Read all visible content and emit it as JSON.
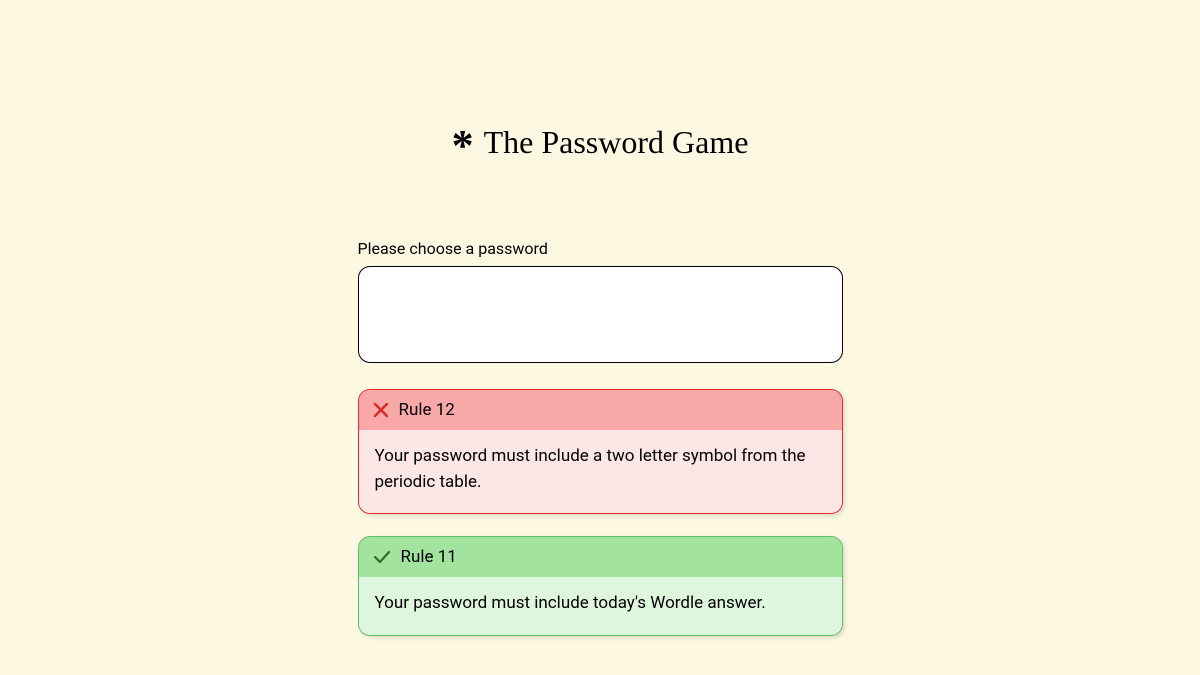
{
  "title": "The Password Game",
  "prompt": "Please choose a password",
  "password_value": "",
  "rules": [
    {
      "status": "fail",
      "label": "Rule 12",
      "text": "Your password must include a two letter symbol from the periodic table."
    },
    {
      "status": "pass",
      "label": "Rule 11",
      "text": "Your password must include today's Wordle answer."
    }
  ]
}
